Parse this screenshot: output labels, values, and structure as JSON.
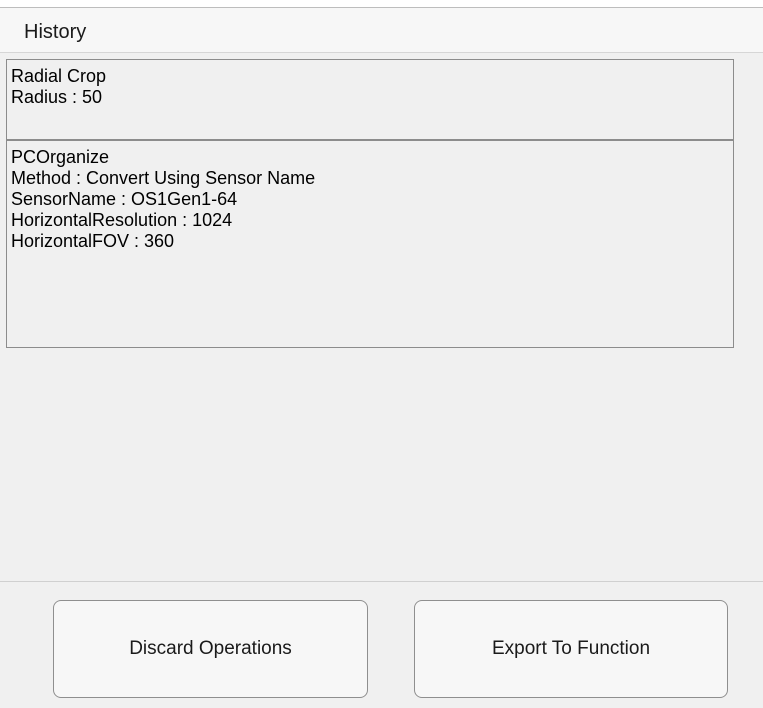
{
  "panel": {
    "title": "History"
  },
  "history": {
    "items": [
      {
        "lines": [
          "Radial Crop",
          "Radius : 50"
        ]
      },
      {
        "lines": [
          "PCOrganize",
          "Method : Convert Using Sensor Name",
          "SensorName : OS1Gen1-64",
          "HorizontalResolution : 1024",
          "HorizontalFOV : 360"
        ]
      }
    ]
  },
  "footer": {
    "discard_label": "Discard Operations",
    "export_label": "Export To Function"
  }
}
